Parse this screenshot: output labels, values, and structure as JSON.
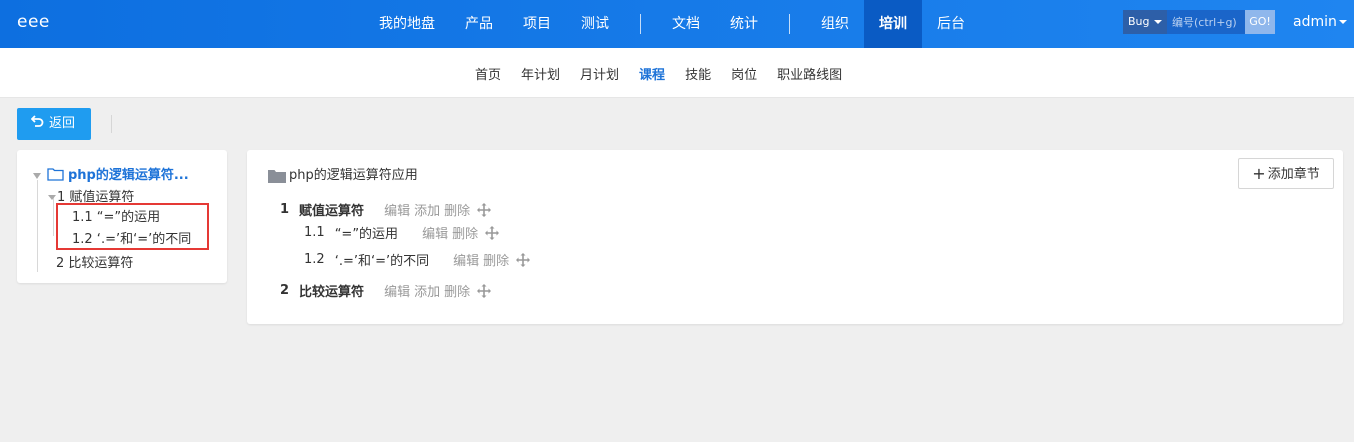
{
  "brand": "eee",
  "nav": {
    "items": [
      {
        "label": "我的地盘"
      },
      {
        "label": "产品"
      },
      {
        "label": "项目"
      },
      {
        "label": "测试"
      },
      {
        "label": "文档"
      },
      {
        "label": "统计"
      },
      {
        "label": "组织"
      },
      {
        "label": "培训"
      },
      {
        "label": "后台"
      }
    ],
    "active": "培训"
  },
  "search": {
    "type": "Bug",
    "placeholder": "编号(ctrl+g)",
    "go": "GO!"
  },
  "user": "admin",
  "subnav": {
    "items": [
      {
        "label": "首页"
      },
      {
        "label": "年计划"
      },
      {
        "label": "月计划"
      },
      {
        "label": "课程"
      },
      {
        "label": "技能"
      },
      {
        "label": "岗位"
      },
      {
        "label": "职业路线图"
      }
    ],
    "active": "课程"
  },
  "back_label": "返回",
  "tree": {
    "root": "php的逻辑运算符...",
    "nodes": [
      {
        "label": "1 赋值运算符"
      },
      {
        "label": "1.1 “=”的运用"
      },
      {
        "label": "1.2 ‘.=’和‘=’的不同"
      },
      {
        "label": "2 比较运算符"
      }
    ]
  },
  "main": {
    "title": "php的逻辑运算符应用",
    "add_chapter": "添加章节",
    "rows": [
      {
        "num": "1",
        "name": "赋值运算符",
        "actions": [
          "编辑",
          "添加",
          "删除"
        ]
      },
      {
        "num": "1.1",
        "name": "“=”的运用",
        "actions": [
          "编辑",
          "删除"
        ]
      },
      {
        "num": "1.2",
        "name": "‘.=’和‘=’的不同",
        "actions": [
          "编辑",
          "删除"
        ]
      },
      {
        "num": "2",
        "name": "比较运算符",
        "actions": [
          "编辑",
          "添加",
          "删除"
        ]
      }
    ]
  },
  "colors": {
    "topbar": "#1f85f0",
    "active_nav": "#0a5bc4",
    "accent": "#1e73d8",
    "back_button": "#1f9cf0",
    "highlight": "#e53935"
  }
}
